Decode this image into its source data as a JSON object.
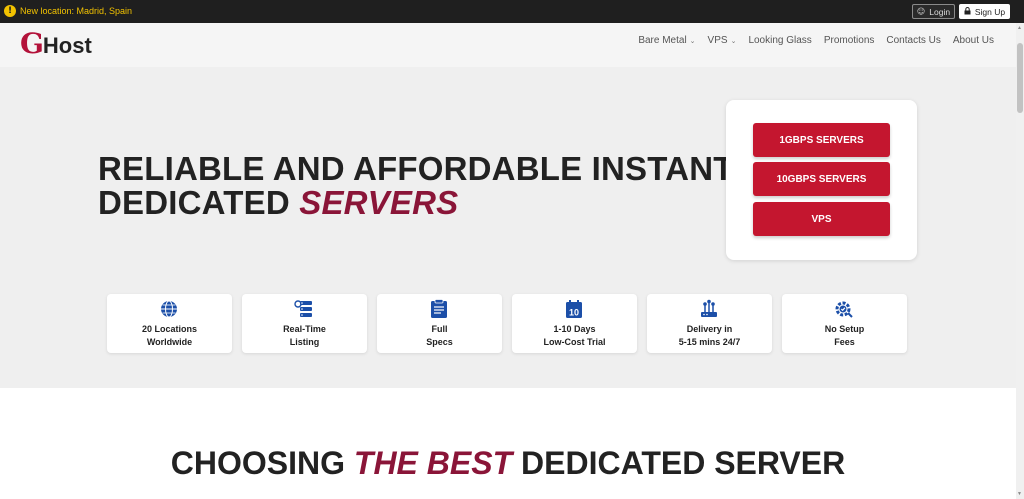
{
  "topbar": {
    "notice_icon": "!",
    "notice_text": "New location: Madrid, Spain",
    "login_label": "Login",
    "signup_label": "Sign Up"
  },
  "header": {
    "logo_mark": "G",
    "logo_text": "Host",
    "nav": [
      {
        "label": "Bare Metal",
        "has_dropdown": true
      },
      {
        "label": "VPS",
        "has_dropdown": true
      },
      {
        "label": "Looking Glass",
        "has_dropdown": false
      },
      {
        "label": "Promotions",
        "has_dropdown": false
      },
      {
        "label": "Contacts Us",
        "has_dropdown": false
      },
      {
        "label": "About Us",
        "has_dropdown": false
      }
    ]
  },
  "hero": {
    "headline_line1": "RELIABLE AND AFFORDABLE INSTANT",
    "headline_line2": "DEDICATED ",
    "headline_accent": "SERVERS",
    "cta": [
      "1GBPS SERVERS",
      "10GBPS SERVERS",
      "VPS"
    ],
    "features": [
      {
        "icon": "globe-icon",
        "line1": "20 Locations",
        "line2": "Worldwide"
      },
      {
        "icon": "server-list-icon",
        "line1": "Real-Time",
        "line2": "Listing"
      },
      {
        "icon": "clipboard-icon",
        "line1": "Full",
        "line2": "Specs"
      },
      {
        "icon": "calendar-icon",
        "calendar_day": "10",
        "line1": "1-10 Days",
        "line2": "Low-Cost Trial"
      },
      {
        "icon": "network-icon",
        "line1": "Delivery in",
        "line2": "5-15 mins 24/7"
      },
      {
        "icon": "gear-check-icon",
        "line1": "No Setup",
        "line2": "Fees"
      }
    ]
  },
  "section2": {
    "title_before": "CHOOSING ",
    "title_accent": "THE BEST",
    "title_after": " DEDICATED SERVER"
  },
  "colors": {
    "brand_red": "#c4162f",
    "accent_maroon": "#8a1538",
    "icon_blue": "#1c4fa8",
    "notice_yellow": "#f2c200",
    "topbar_bg": "#1f1f1f"
  }
}
